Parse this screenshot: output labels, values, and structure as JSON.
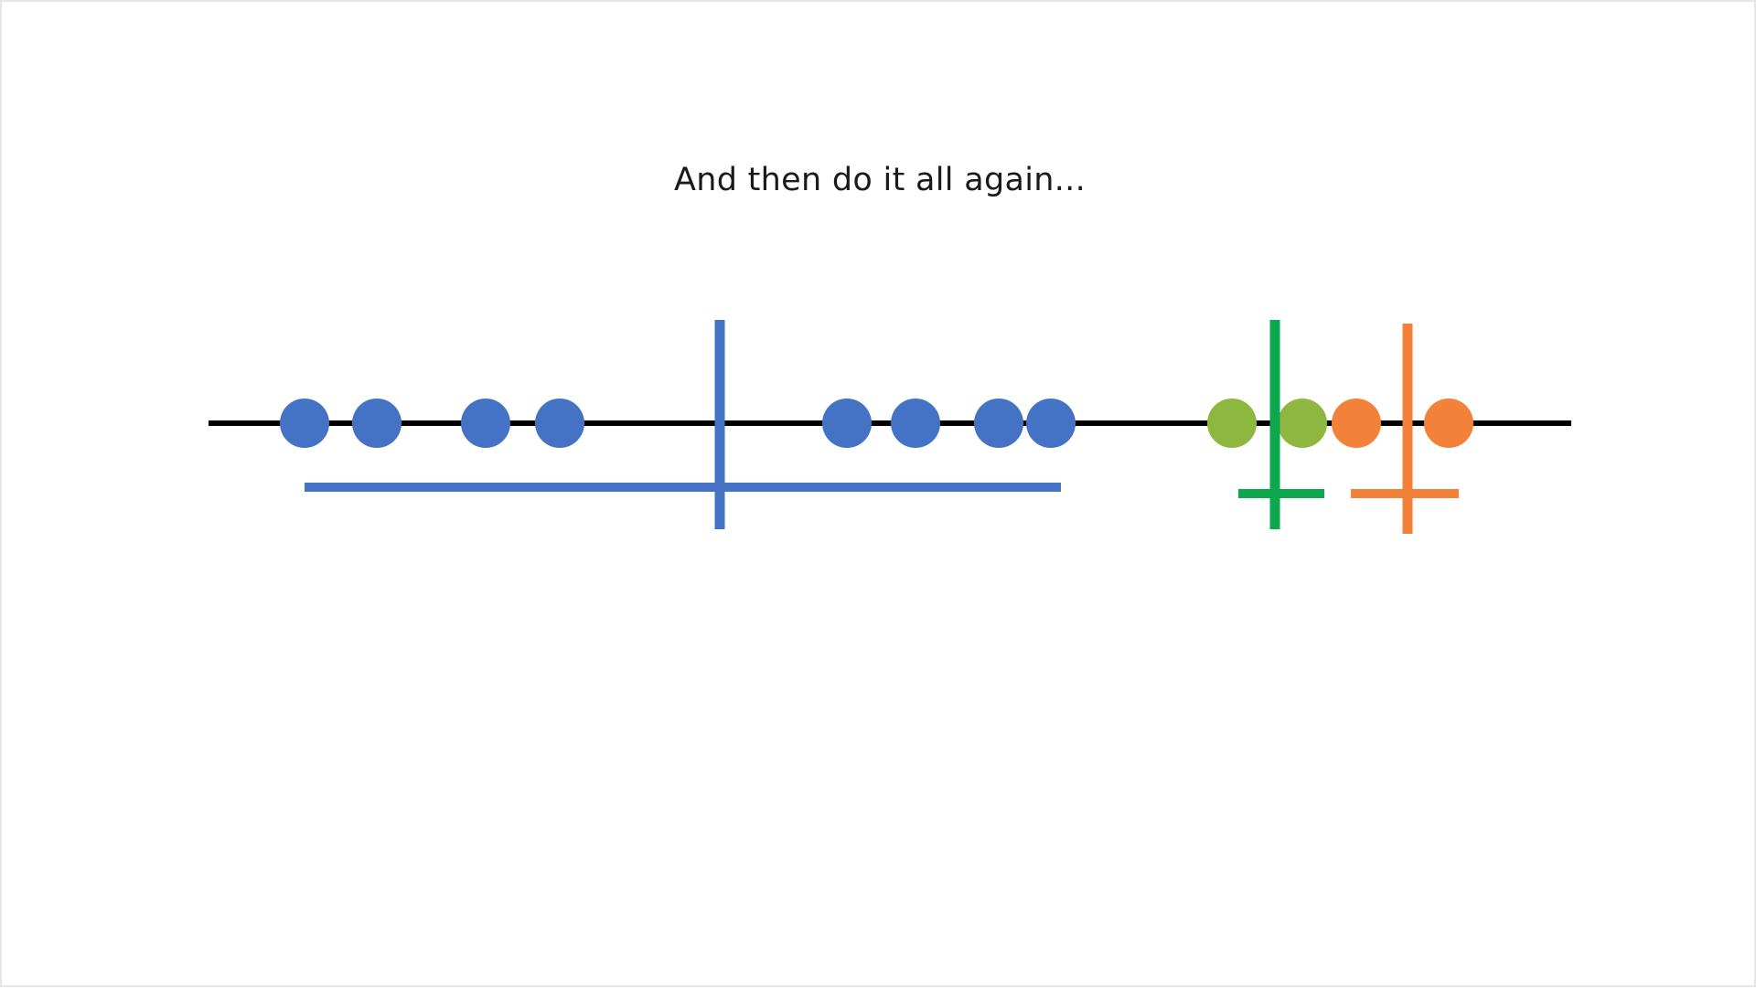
{
  "slide": {
    "title": "And then do it all again..."
  },
  "colors": {
    "axis": "#000000",
    "blue": "#4472C4",
    "green_point": "#8DB73F",
    "green_line": "#0DA84D",
    "orange": "#F2813A",
    "background": "#FFFFFF"
  },
  "diagram": {
    "points": [
      {
        "value": 331,
        "group": "blue"
      },
      {
        "value": 410,
        "group": "blue"
      },
      {
        "value": 529,
        "group": "blue"
      },
      {
        "value": 610,
        "group": "blue"
      },
      {
        "value": 924,
        "group": "blue"
      },
      {
        "value": 999,
        "group": "blue"
      },
      {
        "value": 1090,
        "group": "blue"
      },
      {
        "value": 1147,
        "group": "blue"
      },
      {
        "value": 1345,
        "group": "green"
      },
      {
        "value": 1422,
        "group": "green"
      },
      {
        "value": 1481,
        "group": "orange"
      },
      {
        "value": 1582,
        "group": "orange"
      }
    ],
    "clusters": [
      {
        "group": "blue",
        "center": 785,
        "range": [
          331,
          1158
        ]
      },
      {
        "group": "green",
        "center": 1392,
        "range": [
          1352,
          1446
        ]
      },
      {
        "group": "orange",
        "center": 1537,
        "range": [
          1475,
          1593
        ]
      }
    ]
  }
}
